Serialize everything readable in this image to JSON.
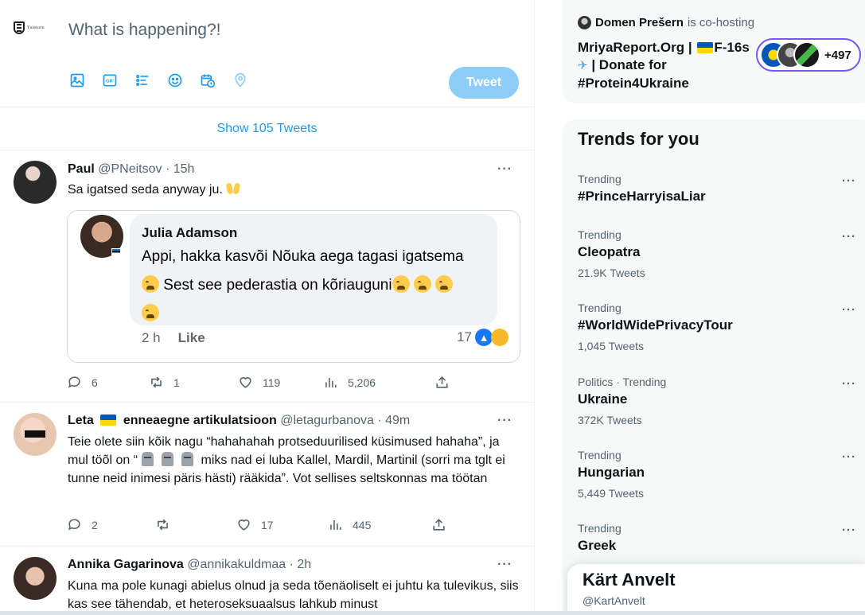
{
  "composer": {
    "avatar_logo_text": "Tuletorn",
    "placeholder": "What is happening?!",
    "tools": [
      "image-icon",
      "gif-icon",
      "poll-icon",
      "emoji-icon",
      "schedule-icon",
      "location-icon"
    ],
    "tweet_button": "Tweet"
  },
  "show_more": "Show 105 Tweets",
  "tweets": [
    {
      "name": "Paul",
      "handle": "@PNeitsov",
      "time": "· 15h",
      "text": "Sa igatsed seda anyway ju.",
      "quote": {
        "name": "Julia Adamson",
        "line1": "Appi, hakka kasvõi Nõuka aega tagasi igatsema",
        "line2": "Sest see pederastia on kõriauguni",
        "time": "2 h",
        "like": "Like",
        "reactions": "17"
      },
      "replies": "6",
      "retweets": "1",
      "likes": "119",
      "views": "5,206"
    },
    {
      "name": "Leta",
      "name_suffix": "enneaegne artikulatsioon",
      "handle": "@letagurbanova",
      "time": "· 49m",
      "text_a": "Teie olete siin kõik nagu “hahahahah protseduurilised küsimused hahaha”, ja mul töõl on “",
      "text_b": "miks nad ei luba Kallel, Mardil, Martinil (sorri ma tglt ei tunne neid inimesi päris hästi) rääkida”. Vot sellises seltskonnas ma töötan",
      "replies": "2",
      "retweets": "",
      "likes": "17",
      "views": "445"
    },
    {
      "name": "Annika Gagarinova",
      "handle": "@annikakuldmaa",
      "time": "· 2h",
      "text": "Kuna ma pole kunagi abielus olnud ja seda tõenäoliselt ei juhtu ka tulevikus, siis kas see tähendab, et heteroseksuaalsus lahkub minust"
    }
  ],
  "space": {
    "host_name": "Domen Prešern",
    "host_suffix": "is co-hosting",
    "title_a": "MriyaReport.Org |",
    "title_b": "F-16s",
    "title_c": "| Donate for #Protein4Ukraine",
    "listener_count": "+497"
  },
  "trends": {
    "heading": "Trends for you",
    "items": [
      {
        "meta": "Trending",
        "name": "#PrinceHarryisaLiar",
        "count": ""
      },
      {
        "meta": "Trending",
        "name": "Cleopatra",
        "count": "21.9K Tweets"
      },
      {
        "meta": "Trending",
        "name": "#WorldWidePrivacyTour",
        "count": "1,045 Tweets"
      },
      {
        "meta": "Politics · Trending",
        "name": "Ukraine",
        "count": "372K Tweets"
      },
      {
        "meta": "Trending",
        "name": "Hungarian",
        "count": "5,449 Tweets"
      },
      {
        "meta": "Trending",
        "name": "Greek",
        "count": ""
      }
    ]
  },
  "profile_popup": {
    "name": "Kärt Anvelt",
    "handle": "@KartAnvelt"
  },
  "colors": {
    "accent": "#1d9bf0",
    "tweet_button_disabled": "#8ecdf8",
    "secondary_text": "#536471",
    "sidebar_bg": "#f7f9f9"
  }
}
